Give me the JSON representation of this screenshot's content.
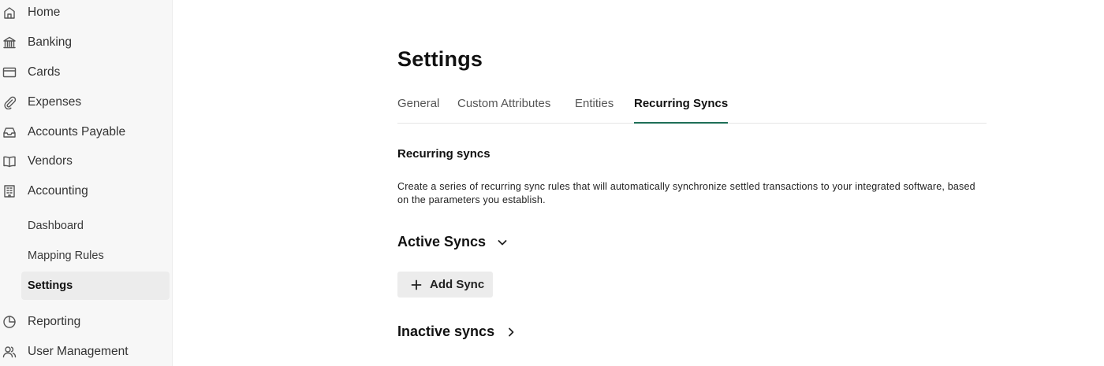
{
  "sidebar": {
    "items": [
      {
        "label": "Home",
        "icon": "home-icon"
      },
      {
        "label": "Banking",
        "icon": "bank-icon"
      },
      {
        "label": "Cards",
        "icon": "card-icon"
      },
      {
        "label": "Expenses",
        "icon": "paperclip-icon"
      },
      {
        "label": "Accounts Payable",
        "icon": "inbox-icon"
      },
      {
        "label": "Vendors",
        "icon": "book-icon"
      },
      {
        "label": "Accounting",
        "icon": "building-icon"
      }
    ],
    "accounting_sub": [
      {
        "label": "Dashboard"
      },
      {
        "label": "Mapping Rules"
      },
      {
        "label": "Settings",
        "active": true
      }
    ],
    "bottom_items": [
      {
        "label": "Reporting",
        "icon": "pie-chart-icon"
      },
      {
        "label": "User Management",
        "icon": "users-icon"
      }
    ]
  },
  "main": {
    "title": "Settings",
    "tabs": [
      {
        "label": "General"
      },
      {
        "label": "Custom Attributes"
      },
      {
        "label": "Entities"
      },
      {
        "label": "Recurring Syncs",
        "active": true
      }
    ],
    "section_title": "Recurring syncs",
    "description": "Create a series of recurring sync rules that will automatically synchronize settled transactions to your integrated software, based on the parameters you establish.",
    "active_group": {
      "label": "Active Syncs",
      "expanded": true
    },
    "add_button": {
      "label": "Add Sync"
    },
    "inactive_group": {
      "label": "Inactive syncs",
      "expanded": false
    }
  },
  "colors": {
    "accent": "#1e6e57",
    "sidebar_bg": "#f7f7f7",
    "button_bg": "#ececec"
  }
}
